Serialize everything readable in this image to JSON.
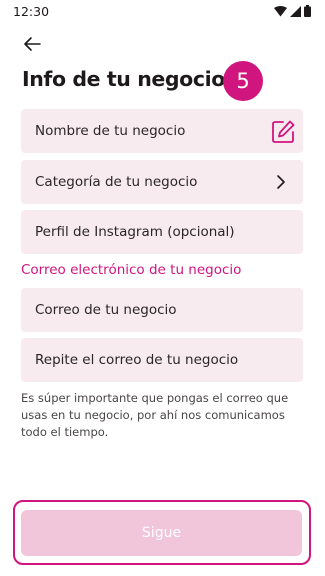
{
  "status_bar": {
    "time": "12:30"
  },
  "header": {
    "back_icon": "arrow-left-icon",
    "title": "Info de tu negocio",
    "step_number": "5"
  },
  "form": {
    "business_name": {
      "placeholder": "Nombre de tu negocio",
      "icon": "edit-icon"
    },
    "category": {
      "placeholder": "Categoría de tu negocio",
      "icon": "chevron-right-icon"
    },
    "instagram": {
      "placeholder": "Perfil de Instagram (opcional)"
    },
    "email_section_label": "Correo electrónico de tu negocio",
    "email": {
      "placeholder": "Correo de tu negocio"
    },
    "email_confirm": {
      "placeholder": "Repite el correo de tu negocio"
    },
    "helper_text": "Es súper importante que pongas el correo que usas en tu negocio, por ahí nos comunicamos todo el tiempo."
  },
  "submit": {
    "label": "Sigue",
    "enabled": false
  },
  "colors": {
    "accent": "#d1157e",
    "field_background": "#f7ebef",
    "button_disabled": "#f1c6da"
  }
}
